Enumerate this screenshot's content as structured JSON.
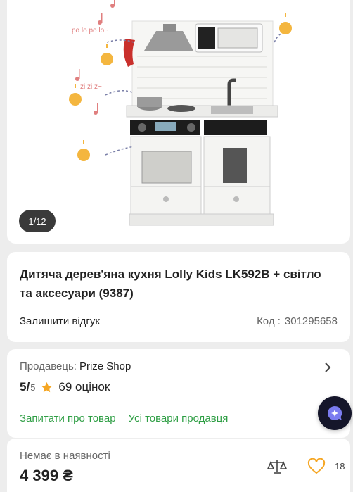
{
  "gallery": {
    "counter": "1/12",
    "annotations": [
      "po lo po lo~",
      "zi zi z~"
    ]
  },
  "product": {
    "title": "Дитяча дерев'яна кухня Lolly Kids LK592B + світло та аксесуари (9387)",
    "review_link": "Залишити відгук",
    "code_label": "Код :",
    "code_value": "301295658"
  },
  "seller": {
    "label": "Продавець:",
    "name": "Prize Shop",
    "rating": "5/",
    "rating_max": "5",
    "reviews": "69 оцінок",
    "ask_link": "Запитати про товар",
    "all_link": "Усі товари продавця"
  },
  "purchase": {
    "availability": "Немає в наявності",
    "price": "4 399 ₴",
    "favorites_count": "18"
  },
  "colors": {
    "accent_green": "#2e9e44",
    "star": "#f5a623",
    "heart": "#f5a623",
    "fab": "#15162a"
  },
  "icons": [
    "chevron-right-icon",
    "star-icon",
    "chat-assistant-icon",
    "compare-scales-icon",
    "heart-icon",
    "bulb-icon",
    "music-note-icon"
  ]
}
